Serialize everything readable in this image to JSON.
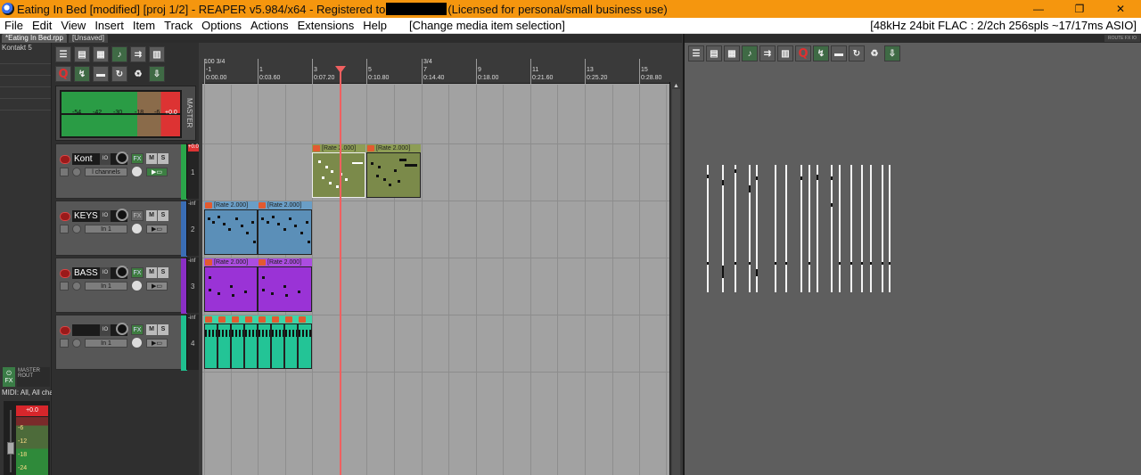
{
  "window": {
    "title_before": "Eating In Bed [modified] [proj 1/2] - REAPER v5.984/x64 - Registered to",
    "title_after": "(Licensed for personal/small business use)",
    "btn_minimize": "—",
    "btn_restore": "❐",
    "btn_close": "✕"
  },
  "menu": {
    "items": [
      "File",
      "Edit",
      "View",
      "Insert",
      "Item",
      "Track",
      "Options",
      "Actions",
      "Extensions",
      "Help"
    ],
    "action_hint": "[Change media item selection]",
    "audio_status": "[48kHz 24bit FLAC : 2/2ch 256spls ~17/17ms ASIO]"
  },
  "project_tabs": [
    {
      "label": "*Eating In Bed.rpp"
    },
    {
      "label": "[Unsaved]"
    }
  ],
  "left_strip": {
    "track_label": "Kontakt 5",
    "fx_label": "FX",
    "io_label": "MASTER\nROUT",
    "midi_label": "MIDI: All, All chan",
    "meter_peak": "+0.0",
    "meter_scale": [
      "-6",
      "-12",
      "-18",
      "-24"
    ]
  },
  "toolbar_icons": {
    "row1": [
      "track-list-icon",
      "mixer-icon",
      "grid-icon",
      "metronome-icon",
      "ripple-icon",
      "item-list-icon"
    ],
    "row2": [
      "quantize-icon",
      "snap-icon",
      "midi-icon",
      "loop-icon",
      "render-icon",
      "settings-icon"
    ]
  },
  "master": {
    "label": "MASTER",
    "scale": [
      "-54",
      "-42",
      "-30",
      "-18",
      "-6",
      "+0.0"
    ]
  },
  "tracks": [
    {
      "name": "Kont",
      "num": "1",
      "peak": "+0.0",
      "hot": true,
      "channels": "l channels",
      "fx_on": true,
      "env_on": true,
      "color": "#2aa64a"
    },
    {
      "name": "KEYS",
      "num": "2",
      "peak": "-inf",
      "hot": false,
      "channels": "In 1",
      "fx_on": false,
      "env_on": false,
      "color": "#3a6db5"
    },
    {
      "name": "BASS",
      "num": "3",
      "peak": "-inf",
      "hot": false,
      "channels": "In 1",
      "fx_on": true,
      "env_on": false,
      "color": "#8b2fc5"
    },
    {
      "name": "",
      "num": "4",
      "peak": "-inf",
      "hot": false,
      "channels": "In 1",
      "fx_on": true,
      "env_on": false,
      "color": "#1fbf8f"
    }
  ],
  "track_buttons": {
    "mute": "M",
    "solo": "S",
    "fx": "FX",
    "io": "IO"
  },
  "ruler": {
    "bar_labels": [
      "-1",
      "1",
      "3",
      "5",
      "7",
      "9",
      "11",
      "13",
      "15"
    ],
    "time_labels": [
      "0:00.00",
      "0:03.60",
      "0:07.20",
      "0:10.80",
      "0:14.40",
      "0:18.00",
      "0:21.60",
      "0:25.20",
      "0:28.80"
    ],
    "tempo_marker": "100 3/4",
    "sig_marker": "3/4"
  },
  "items": {
    "rate_label": "[Rate 2.000]"
  },
  "right_panel": {
    "toolbar_icons": [
      "track-list-icon",
      "mixer-icon",
      "grid-icon",
      "metronome-icon",
      "ripple-icon",
      "item-list-icon",
      "quantize-icon",
      "snap-icon",
      "midi-icon",
      "loop-icon",
      "render-icon",
      "settings-icon"
    ],
    "top_mini": "ROUTE FX IO"
  },
  "colors": {
    "title_bar": "#f5960e",
    "kontakt_item": "#7b8a4a",
    "keys_item": "#5b8fb8",
    "bass_item": "#9a33d6",
    "drums_item": "#23c496"
  }
}
